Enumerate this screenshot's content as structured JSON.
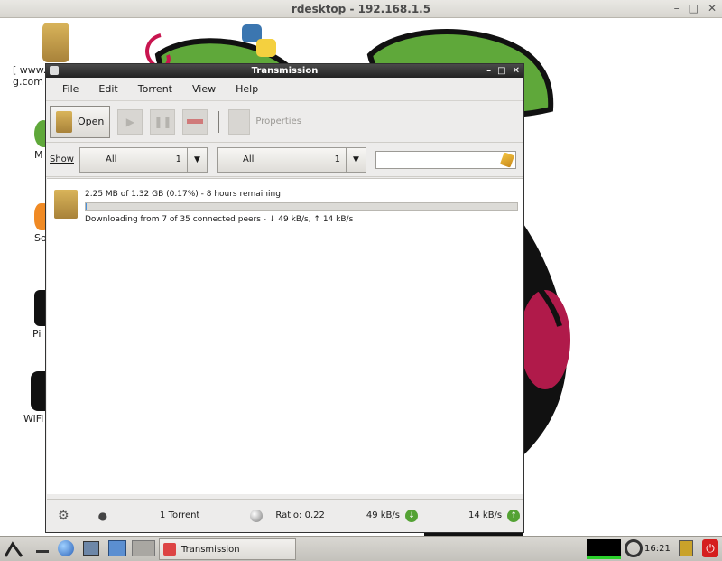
{
  "outer_window": {
    "title": "rdesktop - 192.168.1.5",
    "controls": [
      "–",
      "□",
      "✕"
    ]
  },
  "desktop": {
    "icons": [
      {
        "label": "[ www.",
        "label2": "g.com",
        "icon": "folder-icon"
      },
      {
        "label": "M",
        "icon": "midori-icon"
      },
      {
        "label": "So",
        "icon": "scratch-icon"
      },
      {
        "label": "Pi",
        "icon": "pi-store-icon"
      },
      {
        "label": "WiFi",
        "icon": "wifi-config-icon"
      }
    ]
  },
  "transmission": {
    "title": "Transmission",
    "menu": [
      "File",
      "Edit",
      "Torrent",
      "View",
      "Help"
    ],
    "toolbar": {
      "open_label": "Open",
      "properties_label": "Properties"
    },
    "filter": {
      "show_label": "Show",
      "filter1": {
        "value": "All",
        "count": "1"
      },
      "filter2": {
        "value": "All",
        "count": "1"
      },
      "search_value": ""
    },
    "torrent": {
      "progress_text": "2.25 MB of 1.32 GB (0.17%) - 8 hours remaining",
      "progress_fraction": 0.0017,
      "status_text": "Downloading from 7 of 35 connected peers - ↓ 49 kB/s, ↑ 14 kB/s"
    },
    "statusbar": {
      "torrent_count": "1 Torrent",
      "ratio": "Ratio: 0.22",
      "down_speed": "49 kB/s",
      "up_speed": "14 kB/s"
    }
  },
  "taskbar": {
    "task_label": "Transmission",
    "clock": "16:21"
  },
  "colors": {
    "berry_leaf": "#5fa83a",
    "berry_red": "#b01a4a",
    "outline": "#111111",
    "accent_green": "#54a234"
  }
}
